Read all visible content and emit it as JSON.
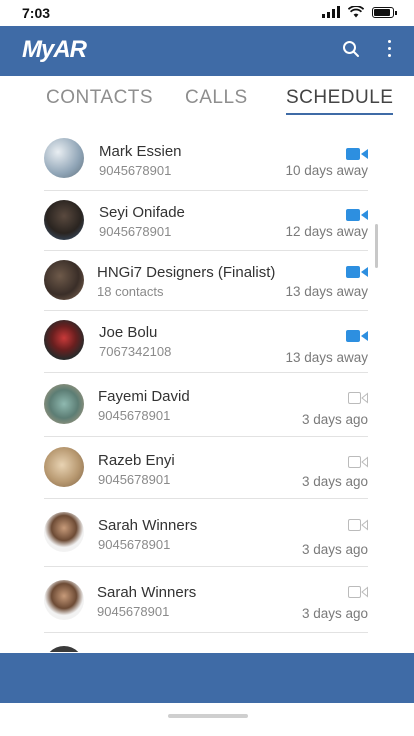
{
  "status_bar": {
    "time": "7:03"
  },
  "app": {
    "logo_text": "MyAR",
    "brand_color": "#3f6ba6"
  },
  "tabs": [
    {
      "label": "CONTACTS",
      "active": false
    },
    {
      "label": "CALLS",
      "active": false
    },
    {
      "label": "SCHEDULE",
      "active": true
    }
  ],
  "schedule": [
    {
      "name": "Mark Essien",
      "detail": "9045678901",
      "when": "10 days away",
      "video_active": true
    },
    {
      "name": "Seyi Onifade",
      "detail": "9045678901",
      "when": "12 days away",
      "video_active": true
    },
    {
      "name": "HNGi7 Designers (Finalist)",
      "detail": "18 contacts",
      "when": "13 days away",
      "video_active": true
    },
    {
      "name": "Joe Bolu",
      "detail": "7067342108",
      "when": "13 days away",
      "video_active": true
    },
    {
      "name": "Fayemi David",
      "detail": "9045678901",
      "when": "3 days ago",
      "video_active": false
    },
    {
      "name": "Razeb Enyi",
      "detail": "9045678901",
      "when": "3 days ago",
      "video_active": false
    },
    {
      "name": "Sarah Winners",
      "detail": "9045678901",
      "when": "3 days ago",
      "video_active": false
    },
    {
      "name": "Sarah Winners",
      "detail": "9045678901",
      "when": "3 days ago",
      "video_active": false
    }
  ]
}
